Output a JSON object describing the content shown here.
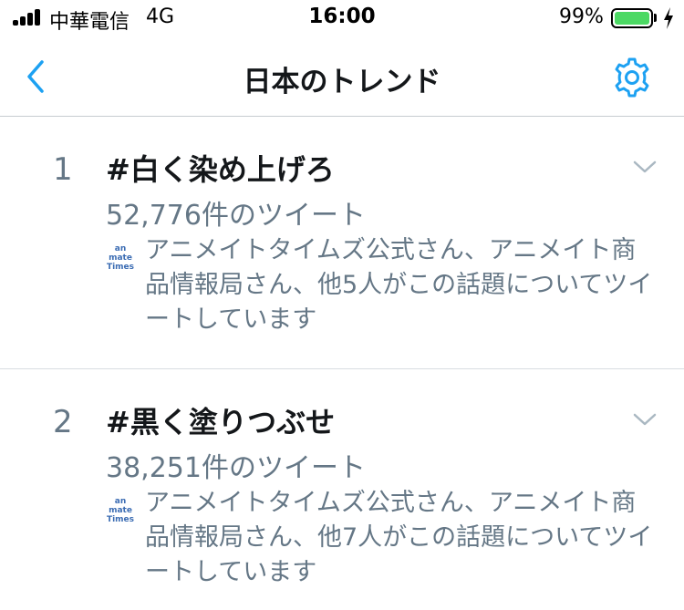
{
  "status_bar": {
    "carrier": "中華電信",
    "network": "4G",
    "time": "16:00",
    "battery_percent": "99%",
    "battery_level": 0.99,
    "battery_color": "#4cd964"
  },
  "nav": {
    "title": "日本のトレンド",
    "back_icon": "chevron-left-icon",
    "settings_icon": "gear-icon",
    "accent_color": "#1da1f2"
  },
  "trends": [
    {
      "rank": "1",
      "name": "#白く染め上げろ",
      "tweet_count": "52,776件のツイート",
      "context_logo": "animate Times",
      "context": "アニメイトタイムズ公式さん、アニメイト商品情報局さん、他5人がこの話題についてツイートしています"
    },
    {
      "rank": "2",
      "name": "#黒く塗りつぶせ",
      "tweet_count": "38,251件のツイート",
      "context_logo": "animate Times",
      "context": "アニメイトタイムズ公式さん、アニメイト商品情報局さん、他7人がこの話題についてツイートしています"
    }
  ]
}
